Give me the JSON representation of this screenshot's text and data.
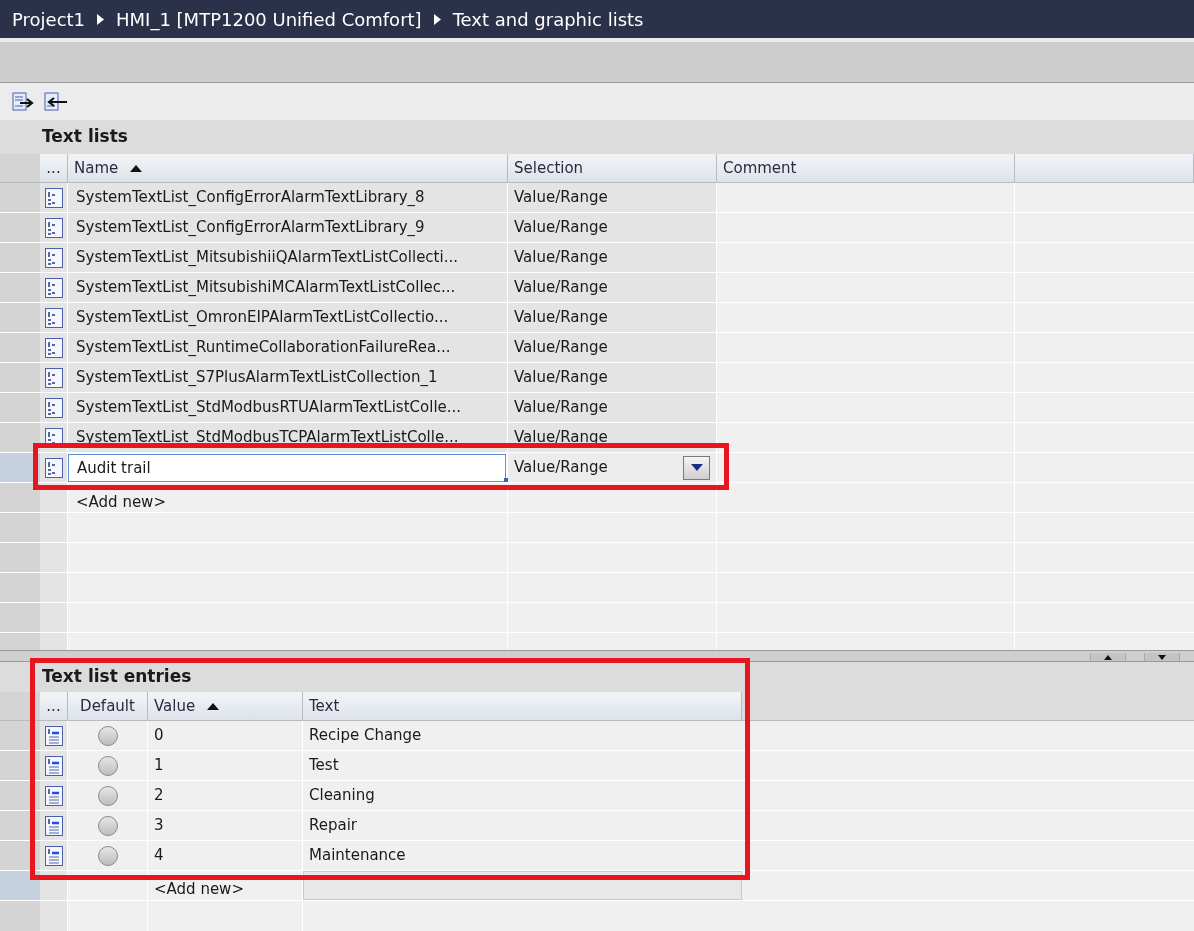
{
  "breadcrumb": [
    "Project1",
    "HMI_1 [MTP1200 Unified Comfort]",
    "Text and graphic lists"
  ],
  "text_lists": {
    "title": "Text lists",
    "columns": [
      "...",
      "Name",
      "Selection",
      "Comment"
    ],
    "rows": [
      {
        "name": "SystemTextList_ConfigErrorAlarmTextLibrary_8",
        "selection": "Value/Range",
        "selected": false
      },
      {
        "name": "SystemTextList_ConfigErrorAlarmTextLibrary_9",
        "selection": "Value/Range",
        "selected": false
      },
      {
        "name": "SystemTextList_MitsubishiiQAlarmTextListCollecti...",
        "selection": "Value/Range",
        "selected": false
      },
      {
        "name": "SystemTextList_MitsubishiMCAlarmTextListCollec...",
        "selection": "Value/Range",
        "selected": false
      },
      {
        "name": "SystemTextList_OmronEIPAlarmTextListCollectio...",
        "selection": "Value/Range",
        "selected": false
      },
      {
        "name": "SystemTextList_RuntimeCollaborationFailureRea...",
        "selection": "Value/Range",
        "selected": false
      },
      {
        "name": "SystemTextList_S7PlusAlarmTextListCollection_1",
        "selection": "Value/Range",
        "selected": false
      },
      {
        "name": "SystemTextList_StdModbusRTUAlarmTextListColle...",
        "selection": "Value/Range",
        "selected": false
      },
      {
        "name": "SystemTextList_StdModbusTCPAlarmTextListColle...",
        "selection": "Value/Range",
        "selected": false
      },
      {
        "name": "Audit trail",
        "selection": "Value/Range",
        "selected": true
      }
    ],
    "add_new": "<Add new>"
  },
  "entries": {
    "title": "Text list entries",
    "columns": [
      "...",
      "Default",
      "Value",
      "Text"
    ],
    "rows": [
      {
        "default": false,
        "value": "0",
        "text": "Recipe Change"
      },
      {
        "default": false,
        "value": "1",
        "text": "Test"
      },
      {
        "default": false,
        "value": "2",
        "text": "Cleaning"
      },
      {
        "default": false,
        "value": "3",
        "text": "Repair"
      },
      {
        "default": false,
        "value": "4",
        "text": "Maintenance"
      }
    ],
    "add_new": "<Add new>"
  }
}
